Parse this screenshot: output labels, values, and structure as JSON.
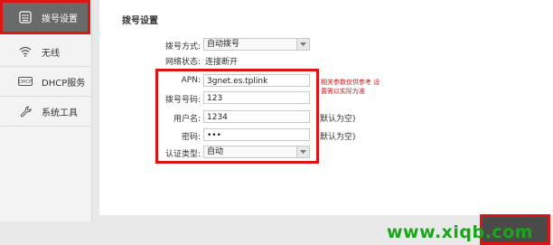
{
  "sidebar": {
    "items": [
      {
        "label": "拨号设置",
        "icon": "dial-icon"
      },
      {
        "label": "无线",
        "icon": "wifi-icon"
      },
      {
        "label": "DHCP服务",
        "icon": "dhcp-icon"
      },
      {
        "label": "系统工具",
        "icon": "wrench-icon"
      }
    ]
  },
  "main": {
    "title": "拨号设置",
    "dial_mode": {
      "label": "拨号方式:",
      "value": "自动拨号"
    },
    "net_status": {
      "label": "网络状态:",
      "value": "连接断开"
    },
    "apn": {
      "label": "APN:",
      "value": "3gnet.es.tplink"
    },
    "dial_number": {
      "label": "拨号号码:",
      "value": "123"
    },
    "username": {
      "label": "用户名:",
      "value": "1234",
      "note": "默认为空)"
    },
    "password": {
      "label": "密码:",
      "value": "•••",
      "note": "默认为空)"
    },
    "auth_type": {
      "label": "认证类型:",
      "value": "自动"
    },
    "hint": "相关参数仅供参考 设置需以实际为准"
  },
  "watermark": "www.xiqb.com",
  "colors": {
    "highlight": "#e01313",
    "watermark": "#1aa61a",
    "active_nav": "#6a6a6a"
  }
}
